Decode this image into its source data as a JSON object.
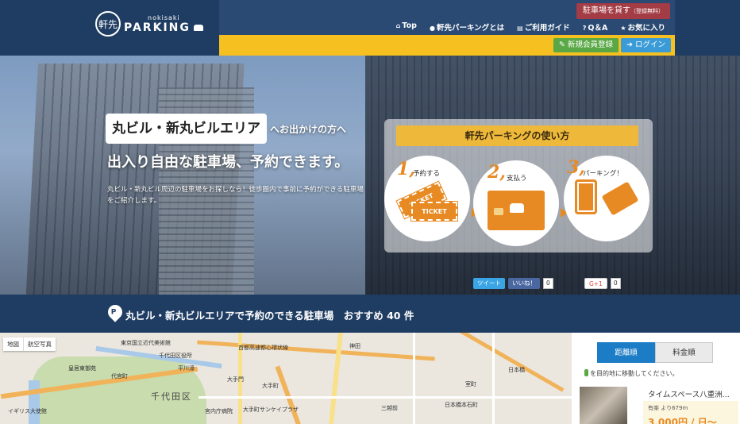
{
  "brand": {
    "logo_circle": "軒先",
    "logo_sub": "nokisaki",
    "logo_main": "PARKING"
  },
  "header": {
    "lend_button": "駐車場を貸す",
    "lend_button_note": "（登録無料）",
    "nav": [
      {
        "icon": "home-icon",
        "glyph": "⌂",
        "label": "Top"
      },
      {
        "icon": "info-icon",
        "glyph": "●",
        "label": "軒先パーキングとは"
      },
      {
        "icon": "book-icon",
        "glyph": "▤",
        "label": "ご利用ガイド"
      },
      {
        "icon": "question-icon",
        "glyph": "?",
        "label": "Q＆A"
      },
      {
        "icon": "star-icon",
        "glyph": "★",
        "label": "お気に入り"
      }
    ],
    "register_button": "✎ 新規会員登録",
    "login_button": "➜ ログイン"
  },
  "hero": {
    "area": "丸ビル・新丸ビルエリア",
    "area_suffix": "へお出かけの方へ",
    "headline": "出入り自由な駐車場、予約できます。",
    "description": "丸ビル・新丸ビル周辺の駐車場をお探しなら！徒歩圏内で事前に予約ができる駐車場をご紹介します。",
    "howto_title": "軒先パーキングの使い方",
    "steps": [
      {
        "num": "1,",
        "label": "予約する",
        "art": "TICKET"
      },
      {
        "num": "2,",
        "label": "支払う",
        "art": ""
      },
      {
        "num": "3,",
        "label": "パーキング！",
        "art": ""
      }
    ],
    "social": {
      "tweet": "ツイート",
      "like": "いいね！",
      "like_count": "0",
      "gplus": "G+1",
      "gplus_count": "0"
    }
  },
  "results": {
    "text": "丸ビル・新丸ビルエリアで予約のできる駐車場　おすすめ 40 件"
  },
  "map": {
    "toggle": [
      "地図",
      "航空写真"
    ],
    "labels": [
      "東京国立近代美術館",
      "千代田区",
      "平川濠",
      "大手町",
      "神田",
      "日本橋",
      "大手門",
      "代官町",
      "千代田区役所",
      "皇居東御苑",
      "大手町サンケイプラザ",
      "日本橋本石町",
      "三越前",
      "室町",
      "宮内庁病院",
      "首都高速都心環状線",
      "イギリス大使館"
    ]
  },
  "sidebar": {
    "sort_tabs": [
      "距離順",
      "料金順"
    ],
    "active_sort": "距離順",
    "move_hint": "を目的地に移動してください。",
    "result": {
      "name": "タイムスペース八重洲...",
      "meta": "有楽 より679m",
      "price": "3,000円 / 日〜"
    }
  },
  "colors": {
    "navy": "#1f3d63",
    "yellow": "#f5c020",
    "orange": "#e88a23",
    "green": "#5aa845",
    "blue": "#1c7cc6"
  }
}
